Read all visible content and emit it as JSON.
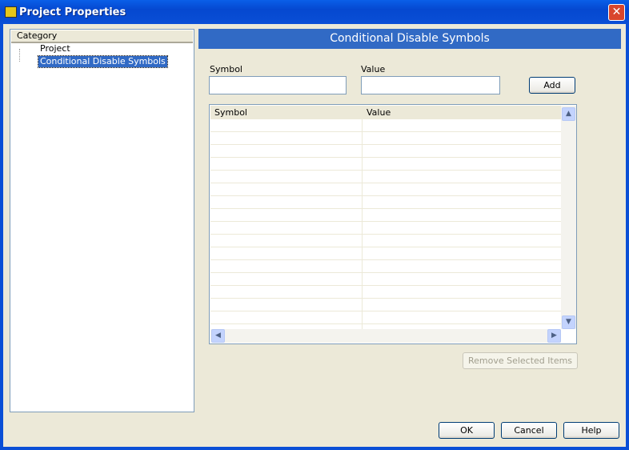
{
  "window": {
    "title": "Project Properties"
  },
  "category": {
    "header": "Category",
    "items": [
      {
        "label": "Project"
      },
      {
        "label": "Conditional Disable Symbols"
      }
    ]
  },
  "panel": {
    "title": "Conditional Disable Symbols",
    "symbol_label": "Symbol",
    "symbol_value": "",
    "value_label": "Value",
    "value_value": "",
    "add_label": "Add",
    "table": {
      "columns": [
        "Symbol",
        "Value"
      ],
      "rows": []
    },
    "remove_label": "Remove Selected Items"
  },
  "footer": {
    "ok": "OK",
    "cancel": "Cancel",
    "help": "Help"
  }
}
